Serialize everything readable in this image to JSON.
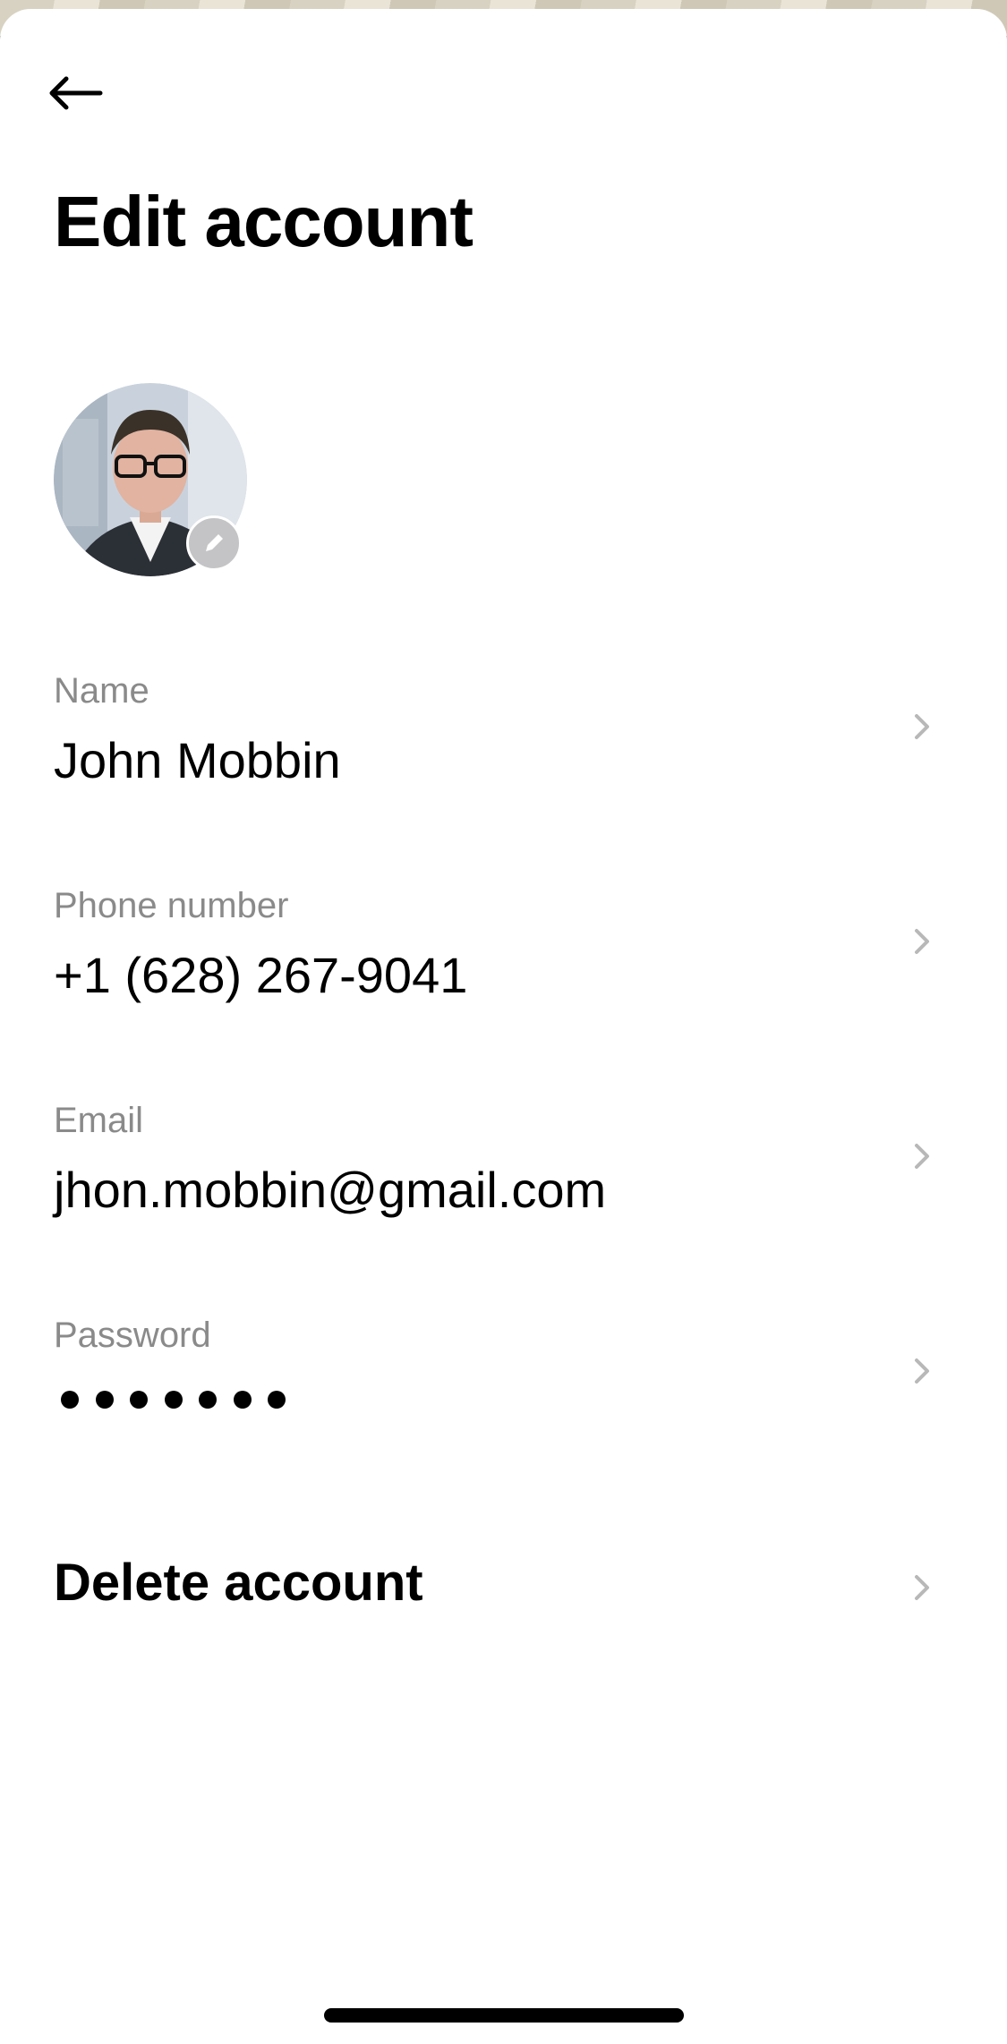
{
  "header": {
    "title": "Edit account",
    "back_icon": "arrow-left-icon"
  },
  "avatar": {
    "alt": "Profile photo",
    "edit_icon": "pencil-icon"
  },
  "fields": [
    {
      "label": "Name",
      "value": "John Mobbin"
    },
    {
      "label": "Phone number",
      "value": "+1 (628) 267-9041"
    },
    {
      "label": "Email",
      "value": "jhon.mobbin@gmail.com"
    },
    {
      "label": "Password",
      "masked_length": 7
    }
  ],
  "delete": {
    "label": "Delete account"
  },
  "colors": {
    "label": "#8a8a8a",
    "text": "#000000",
    "chevron": "#b8b8b8",
    "edit_badge": "#c4c4c6"
  }
}
